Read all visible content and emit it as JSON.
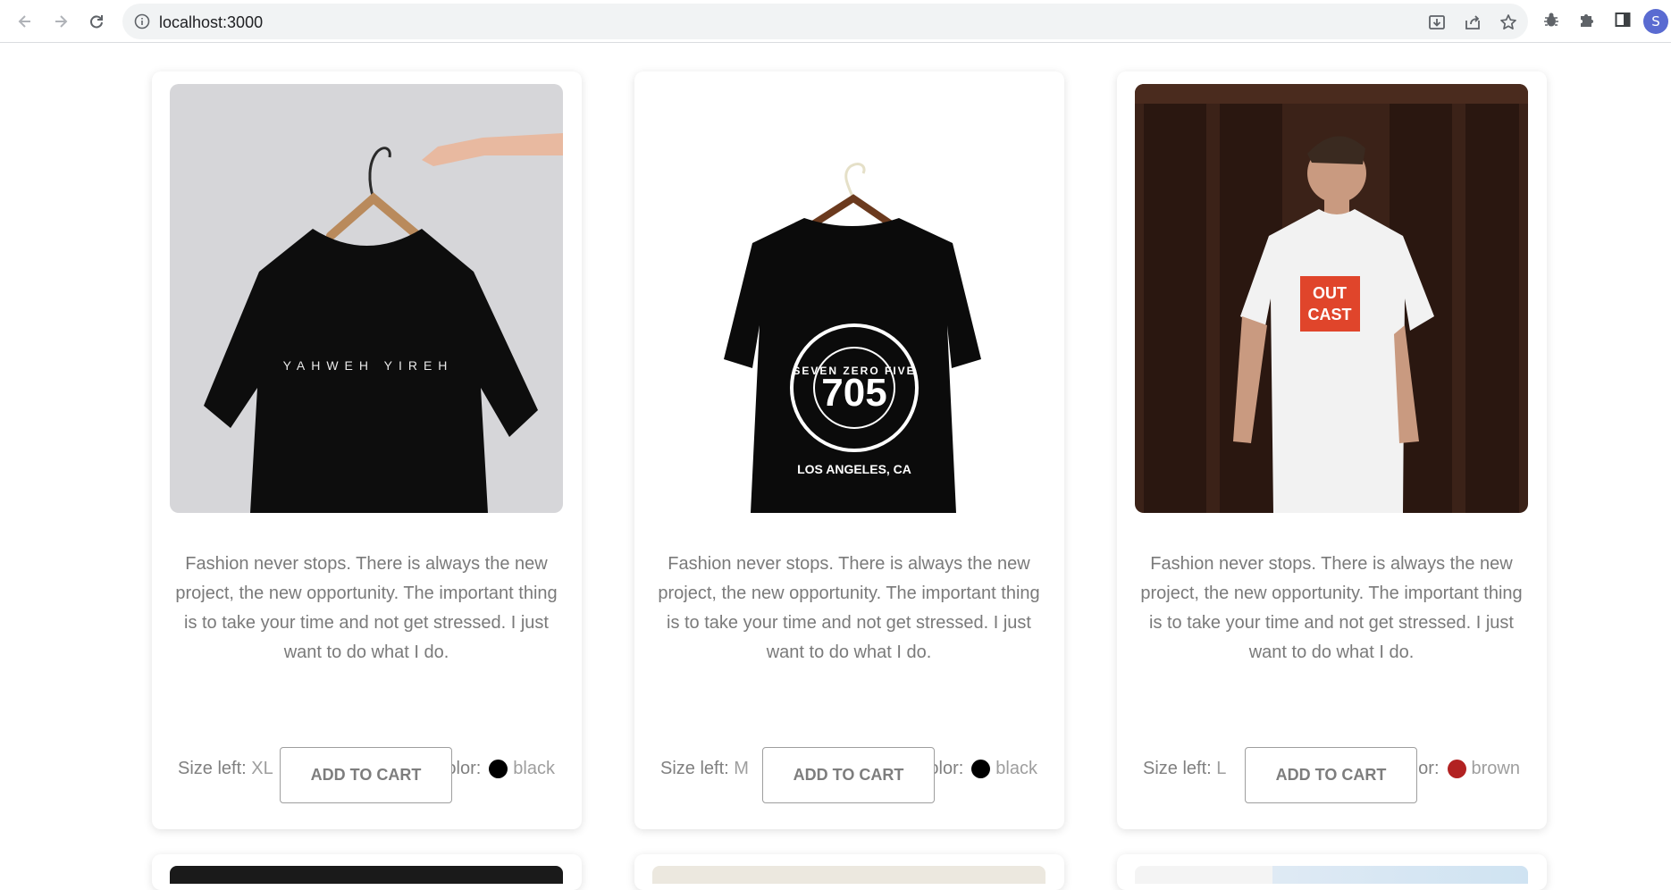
{
  "browser": {
    "url": "localhost:3000",
    "avatar_letter": "S",
    "icons": [
      "back-arrow-icon",
      "forward-arrow-icon",
      "reload-icon",
      "info-icon",
      "download-icon",
      "share-icon",
      "star-icon",
      "bug-icon",
      "puzzle-icon",
      "sidepanel-icon"
    ]
  },
  "products": [
    {
      "description": "Fashion never stops. There is always the new project, the new opportunity. The important thing is to take your time and not get stressed. I just want to do what I do.",
      "size_label": "Size left:",
      "size_value": "XL",
      "color_label": "Color:",
      "color_name": "black",
      "color_hex": "#000000",
      "button_label": "ADD TO CART",
      "shirt_text": "YAHWEH YIREH"
    },
    {
      "description": "Fashion never stops. There is always the new project, the new opportunity. The important thing is to take your time and not get stressed. I just want to do what I do.",
      "size_label": "Size left:",
      "size_value": "M",
      "color_label": "Color:",
      "color_name": "black",
      "color_hex": "#000000",
      "button_label": "ADD TO CART",
      "shirt_number": "705",
      "shirt_ring_text": "SEVEN ZERO FIVE",
      "shirt_city": "LOS ANGELES, CA"
    },
    {
      "description": "Fashion never stops. There is always the new project, the new opportunity. The important thing is to take your time and not get stressed. I just want to do what I do.",
      "size_label": "Size left:",
      "size_value": "L",
      "color_label": "Color:",
      "color_name": "brown",
      "color_hex": "#b22222",
      "button_label": "ADD TO CART",
      "shirt_text_line1": "OUT",
      "shirt_text_line2": "CAST"
    }
  ]
}
